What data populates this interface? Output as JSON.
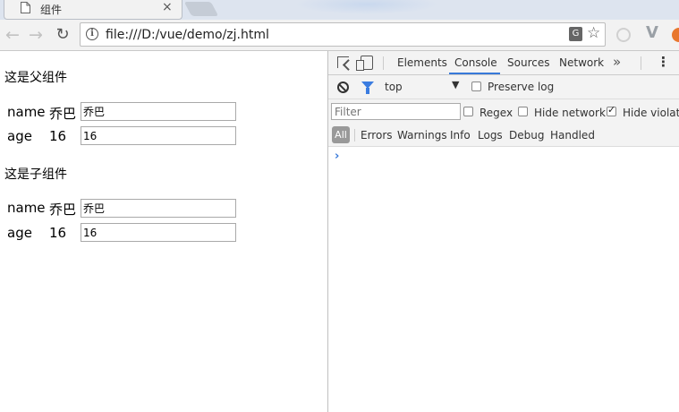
{
  "tab": {
    "title": "组件",
    "close": "×"
  },
  "toolbar": {
    "back": "←",
    "forward": "→",
    "reload": "↻",
    "url": "file:///D:/vue/demo/zj.html",
    "info": "i",
    "translate": "G",
    "star": "☆",
    "ext_vue": "V"
  },
  "page": {
    "parent_heading": "这是父组件",
    "child_heading": "这是子组件",
    "parent": {
      "name_label": "name",
      "name_value": "乔巴",
      "name_input": "乔巴",
      "age_label": "age",
      "age_value": "16",
      "age_input": "16"
    },
    "child": {
      "name_label": "name",
      "name_value": "乔巴",
      "name_input": "乔巴",
      "age_label": "age",
      "age_value": "16",
      "age_input": "16"
    }
  },
  "devtools": {
    "tabs": [
      "Elements",
      "Console",
      "Sources",
      "Network"
    ],
    "active_tab": "Console",
    "more": "»",
    "menu": "⋮",
    "context": "top",
    "context_arrow": "▼",
    "preserve_log": "Preserve log",
    "filter_placeholder": "Filter",
    "regex": "Regex",
    "hide_network": "Hide network",
    "hide_violations": "Hide violations",
    "levels": [
      "All",
      "Errors",
      "Warnings",
      "Info",
      "Logs",
      "Debug",
      "Handled"
    ],
    "prompt": "›",
    "accent": "#3879d9"
  }
}
